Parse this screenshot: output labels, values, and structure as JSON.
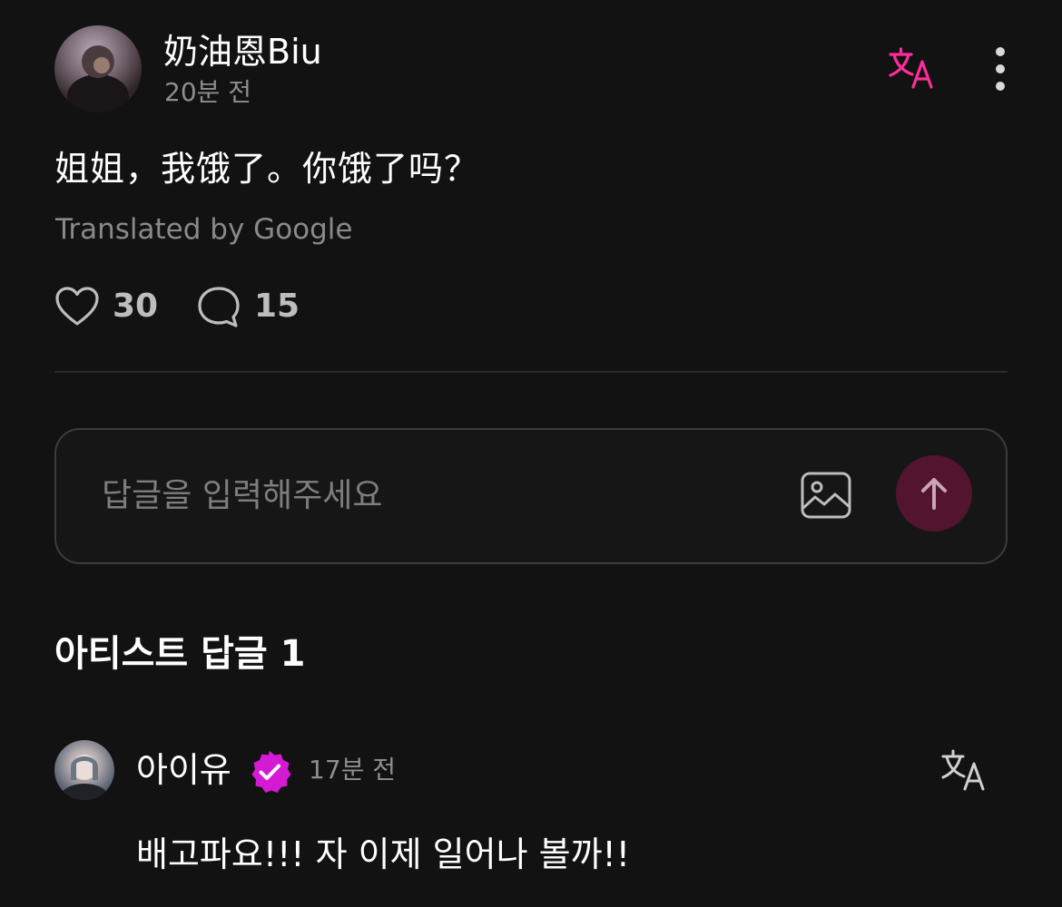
{
  "post": {
    "author_name": "奶油恩Biu",
    "time": "20분 전",
    "body": "姐姐，我饿了。你饿了吗？",
    "translation_note": "Translated by Google",
    "likes": "30",
    "comments": "15",
    "icons": {
      "avatar": "user-avatar",
      "translate": "translate-icon",
      "more": "more-vertical-icon",
      "like": "heart-icon",
      "comment": "comment-bubble-icon"
    }
  },
  "reply_input": {
    "placeholder": "답글을 입력해주세요",
    "value": "",
    "image_icon": "image-icon",
    "send_icon": "arrow-up-icon"
  },
  "artist_replies": {
    "title": "아티스트 답글 1",
    "items": [
      {
        "author_name": "아이유",
        "time": "17분 전",
        "body": "배고파요!!! 자 이제 일어나 볼까!!",
        "verified": true,
        "badge_icon": "verified-check-icon",
        "translate_icon": "translate-icon"
      }
    ]
  },
  "colors": {
    "background": "#121212",
    "accent": "#ff2d9a",
    "badge": "#d51ad6",
    "send_button": "#52142f",
    "muted_text": "#8e8e8e"
  }
}
